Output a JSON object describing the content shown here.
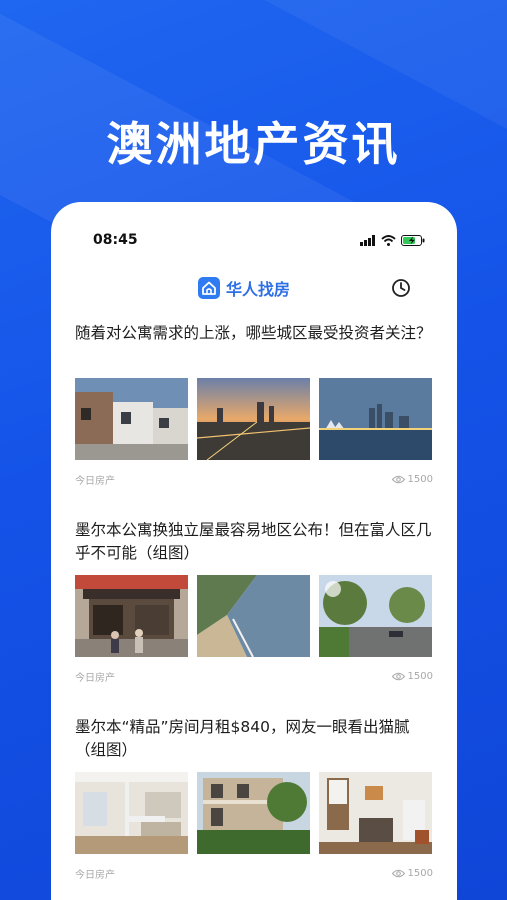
{
  "promo": {
    "title": "澳洲地产资讯"
  },
  "status_bar": {
    "time": "08:45"
  },
  "nav": {
    "brand_name": "华人找房",
    "icons": [
      "house-logo-icon",
      "history-clock-icon"
    ]
  },
  "articles": [
    {
      "title": "随着对公寓需求的上涨，哪些城区最受投资者关注？",
      "source": "今日房产",
      "views": "1500",
      "images": [
        "townhouses-photo",
        "city-sunset-aerial-photo",
        "harbour-skyline-photo"
      ]
    },
    {
      "title": "墨尔本公寓换独立屋最容易地区公布！但在富人区几乎不可能（组图）",
      "source": "今日房产",
      "views": "1500",
      "images": [
        "bakehouse-storefront-photo",
        "beach-coastline-photo",
        "tree-lined-street-photo"
      ]
    },
    {
      "title": "墨尔本“精品”房间月租$840，网友一眼看出猫腻（组图）",
      "source": "今日房产",
      "views": "1500",
      "images": [
        "room-bunk-bed-photo",
        "terrace-house-photo",
        "old-kitchen-photo"
      ]
    }
  ],
  "colors": {
    "background": "#1553e8",
    "brand": "#2f6fe6",
    "meta": "#a8a8a8"
  }
}
